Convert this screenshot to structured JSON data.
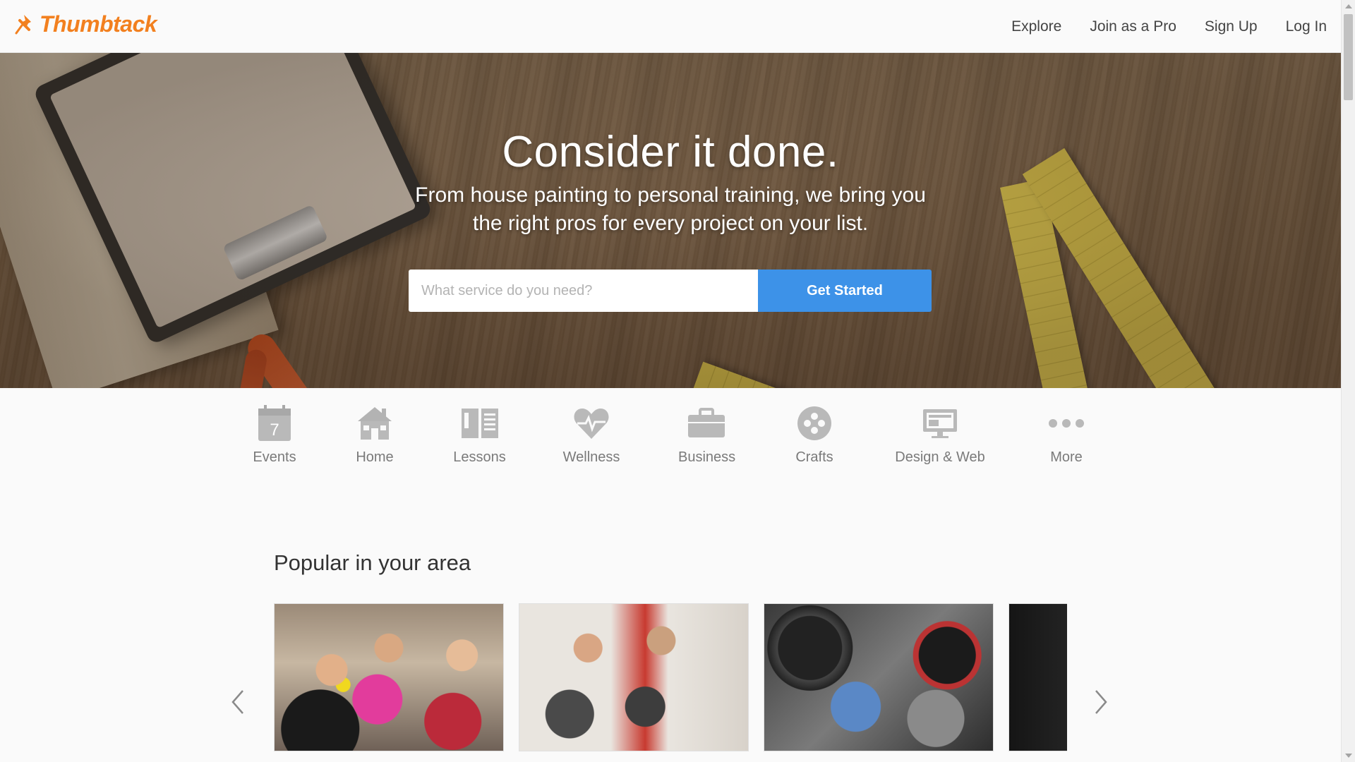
{
  "brand": {
    "name": "Thumbtack",
    "color": "#f2801f"
  },
  "nav": {
    "items": [
      "Explore",
      "Join as a Pro",
      "Sign Up",
      "Log In"
    ]
  },
  "hero": {
    "title": "Consider it done.",
    "subtitle": "From house painting to personal training, we bring you the right pros for every project on your list.",
    "search_placeholder": "What service do you need?",
    "search_value": "",
    "button_label": "Get Started",
    "button_color": "#3d92e8"
  },
  "categories": [
    {
      "label": "Events",
      "icon": "calendar-icon",
      "calendar_day": "7"
    },
    {
      "label": "Home",
      "icon": "house-icon"
    },
    {
      "label": "Lessons",
      "icon": "book-icon"
    },
    {
      "label": "Wellness",
      "icon": "heart-icon"
    },
    {
      "label": "Business",
      "icon": "briefcase-icon"
    },
    {
      "label": "Crafts",
      "icon": "palette-icon"
    },
    {
      "label": "Design & Web",
      "icon": "monitor-icon"
    },
    {
      "label": "More",
      "icon": "more-dots-icon"
    }
  ],
  "popular": {
    "title": "Popular in your area",
    "cards": [
      {
        "image": "party-photo-booth-image"
      },
      {
        "image": "boxing-training-image"
      },
      {
        "image": "dj-turntable-records-image"
      },
      {
        "image": "makeup-tools-image"
      }
    ]
  }
}
